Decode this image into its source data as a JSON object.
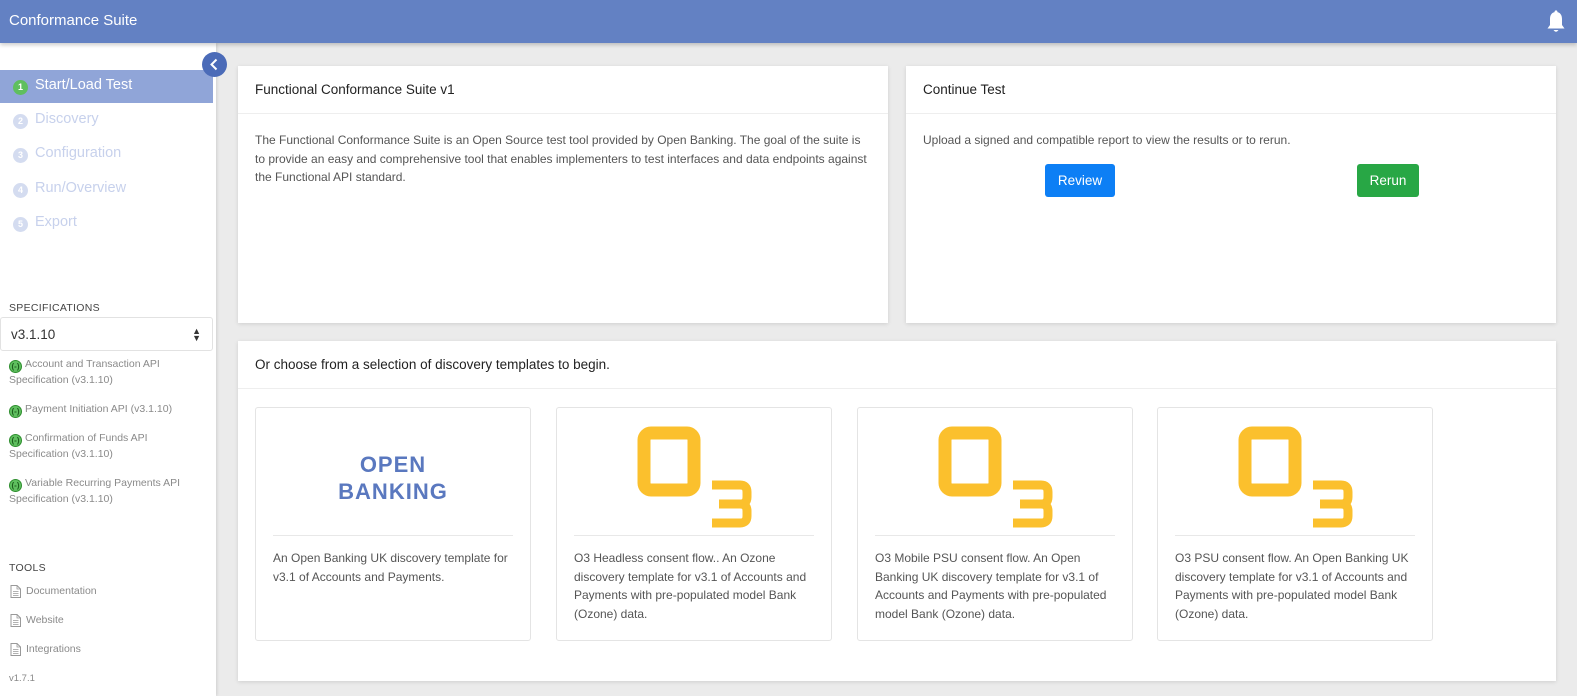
{
  "app": {
    "title": "Conformance Suite"
  },
  "steps": [
    {
      "num": "1",
      "label": "Start/Load Test"
    },
    {
      "num": "2",
      "label": "Discovery"
    },
    {
      "num": "3",
      "label": "Configuration"
    },
    {
      "num": "4",
      "label": "Run/Overview"
    },
    {
      "num": "5",
      "label": "Export"
    }
  ],
  "specifications": {
    "title": "SPECIFICATIONS",
    "selected": "v3.1.10",
    "items": [
      {
        "status": "(-)",
        "label": "Account and Transaction API Specification (v3.1.10)"
      },
      {
        "status": "(-)",
        "label": "Payment Initiation API (v3.1.10)"
      },
      {
        "status": "(-)",
        "label": "Confirmation of Funds API Specification (v3.1.10)"
      },
      {
        "status": "(-)",
        "label": "Variable Recurring Payments API Specification (v3.1.10)"
      }
    ]
  },
  "tools": {
    "title": "TOOLS",
    "items": [
      "Documentation",
      "Website",
      "Integrations"
    ]
  },
  "version": "v1.7.1",
  "intro_card": {
    "title": "Functional Conformance Suite v1",
    "text": "The Functional Conformance Suite is an Open Source test tool provided by Open Banking. The goal of the suite is to provide an easy and comprehensive tool that enables implementers to test interfaces and data endpoints against the Functional API standard."
  },
  "continue_card": {
    "title": "Continue Test",
    "text": "Upload a signed and compatible report to view the results or to rerun.",
    "review_label": "Review",
    "rerun_label": "Rerun"
  },
  "templates_card": {
    "title": "Or choose from a selection of discovery templates to begin.",
    "templates": [
      {
        "logo_line1": "OPEN",
        "logo_line2": "BANKING",
        "description": "An Open Banking UK discovery template for v3.1 of Accounts and Payments."
      },
      {
        "logo_text": "O3",
        "description": "O3 Headless consent flow.. An Ozone discovery template for v3.1 of Accounts and Payments with pre-populated model Bank (Ozone) data."
      },
      {
        "logo_text": "O3",
        "description": "O3 Mobile PSU consent flow. An Open Banking UK discovery template for v3.1 of Accounts and Payments with pre-populated model Bank (Ozone) data."
      },
      {
        "logo_text": "O3",
        "description": "O3 PSU consent flow. An Open Banking UK discovery template for v3.1 of Accounts and Payments with pre-populated model Bank (Ozone) data."
      }
    ]
  },
  "colors": {
    "topbar": "#6381c3",
    "active_step": "#90a5d8",
    "primary_button": "#0d7ff5",
    "success_button": "#28a745",
    "o3_logo": "#fbc02d",
    "ob_logo": "#5a78bf"
  }
}
